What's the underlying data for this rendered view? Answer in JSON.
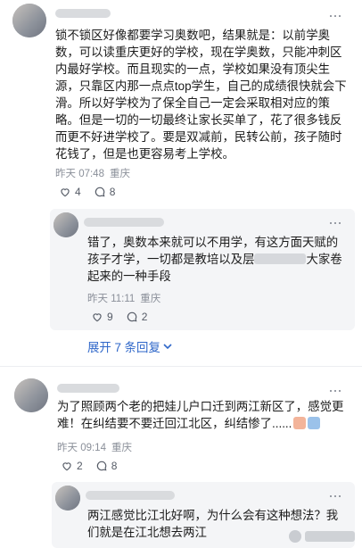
{
  "comment1": {
    "text": "锁不锁区好像都要学习奥数吧，结果就是：以前学奥数，可以读重庆更好的学校，现在学奥数，只能冲刺区内最好学校。而且现实的一点，学校如果没有顶尖生源，只靠区内那一点点top学生，自己的成绩很快就会下滑。所以好学校为了保全自己一定会采取相对应的策略。但是一切的一切最终让家长买单了，花了很多钱反而更不好进学校了。要是双减前，民转公前，孩子随时花钱了，但是也更容易考上学校。",
    "time": "昨天 07:48",
    "location": "重庆",
    "likes": "4",
    "replies": "8"
  },
  "reply1": {
    "text_before": "错了，奥数本来就可以不用学，有这方面天赋的孩子才学，一切都是教培以及层",
    "text_after": "大家卷起来的一种手段",
    "time": "昨天 11:11",
    "location": "重庆",
    "likes": "9",
    "replies": "2"
  },
  "expand": {
    "label": "展开 7 条回复"
  },
  "comment2": {
    "text": "为了照顾两个老的把娃儿户口迁到两江新区了，感觉更难！在纠结要不要迁回江北区，纠结惨了......",
    "time": "昨天 09:14",
    "location": "重庆",
    "likes": "2",
    "replies": "8"
  },
  "reply2": {
    "text": "两江感觉比江北好啊，为什么会有这种想法？我们就是在江北想去两江"
  },
  "icons": {
    "like": "heart-icon",
    "reply": "comment-icon",
    "more": "more-dots-icon",
    "expand": "chevron-down-icon"
  },
  "colors": {
    "link": "#2f67c9",
    "meta": "#8a8f99",
    "reply_bg": "#f4f5f7"
  }
}
